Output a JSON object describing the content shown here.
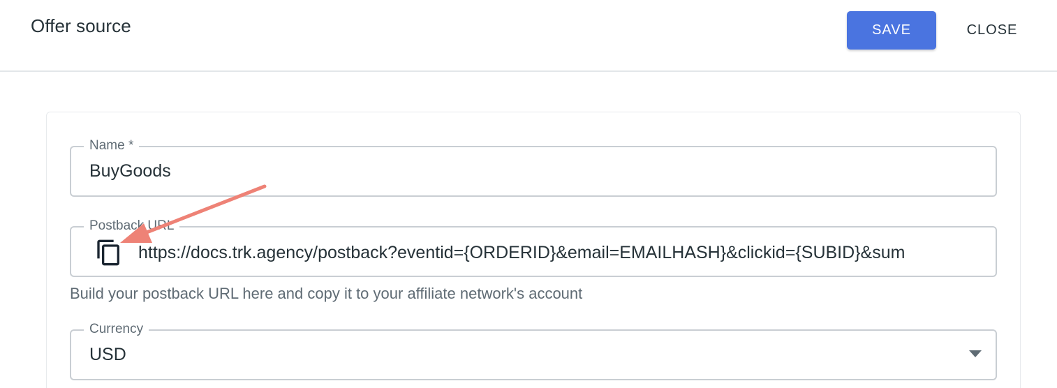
{
  "header": {
    "title": "Offer source",
    "save_label": "SAVE",
    "close_label": "CLOSE"
  },
  "form": {
    "name": {
      "label": "Name *",
      "value": "BuyGoods"
    },
    "postback": {
      "label": "Postback URL",
      "value": "https://docs.trk.agency/postback?eventid={ORDERID}&email=EMAILHASH}&clickid={SUBID}&sum",
      "helper": "Build your postback URL here and copy it to your affiliate network's account",
      "copy_icon": "copy-icon"
    },
    "currency": {
      "label": "Currency",
      "value": "USD",
      "dropdown_icon": "chevron-down-icon"
    }
  },
  "colors": {
    "primary": "#4a74e0",
    "annotation_arrow": "#ee8276",
    "border": "#c9ced3",
    "text": "#263238",
    "muted": "#5f6b74"
  }
}
